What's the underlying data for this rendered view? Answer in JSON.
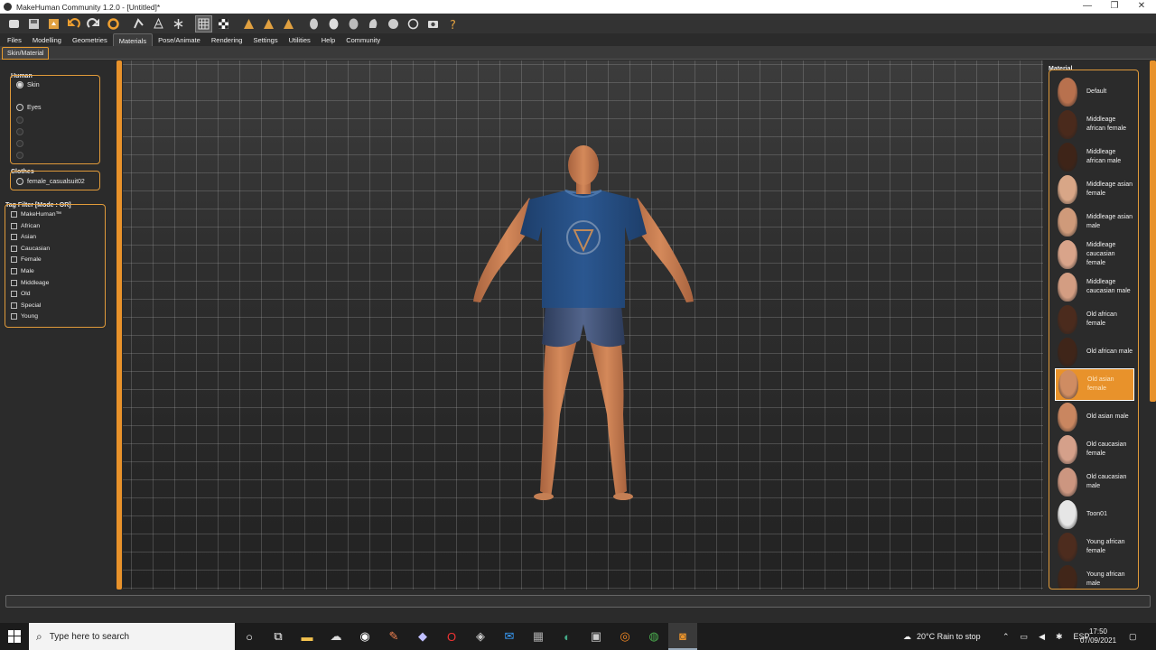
{
  "window": {
    "title": "MakeHuman Community 1.2.0 - [Untitled]*",
    "minimize": "—",
    "maximize": "❐",
    "close": "✕"
  },
  "toolbar": {
    "icons": [
      "new-icon",
      "save-icon",
      "export-icon",
      "undo-icon",
      "redo-icon",
      "reset-icon",
      "pose-icon",
      "wireframe-icon",
      "skeleton-icon",
      "grid-icon",
      "checker-icon",
      "front-view-icon",
      "side-view-icon",
      "top-view-icon",
      "face-front-icon",
      "face-side-icon",
      "face-back-icon",
      "face-left-icon",
      "face-right-icon",
      "reset-camera-icon",
      "snapshot-icon",
      "help-icon"
    ]
  },
  "tabs": [
    {
      "label": "Files"
    },
    {
      "label": "Modelling"
    },
    {
      "label": "Geometries"
    },
    {
      "label": "Materials",
      "active": true
    },
    {
      "label": "Pose/Animate"
    },
    {
      "label": "Rendering"
    },
    {
      "label": "Settings"
    },
    {
      "label": "Utilities"
    },
    {
      "label": "Help"
    },
    {
      "label": "Community"
    }
  ],
  "subtab": {
    "label": "Skin/Material"
  },
  "left": {
    "human": {
      "title": "Human",
      "options": [
        {
          "label": "Skin",
          "selected": true
        },
        {
          "label": "Eyes",
          "selected": false
        }
      ]
    },
    "clothes": {
      "title": "Clothes",
      "item": "female_casualsuit02"
    },
    "tagfilter": {
      "title": "Tag Filter [Mode : OR]",
      "tags": [
        "MakeHuman™",
        "African",
        "Asian",
        "Caucasian",
        "Female",
        "Male",
        "Middleage",
        "Old",
        "Special",
        "Young"
      ]
    }
  },
  "material": {
    "title": "Material",
    "items": [
      {
        "label": "Default",
        "tone": "#b8714e"
      },
      {
        "label": "Middleage african female",
        "tone": "#4a2a1c"
      },
      {
        "label": "Middleage african male",
        "tone": "#3e2418"
      },
      {
        "label": "Middleage asian female",
        "tone": "#d8a687"
      },
      {
        "label": "Middleage asian male",
        "tone": "#cf9a7a"
      },
      {
        "label": "Middleage caucasian female",
        "tone": "#d9a48a"
      },
      {
        "label": "Middleage caucasian male",
        "tone": "#d39d82"
      },
      {
        "label": "Old african female",
        "tone": "#4b2b1d"
      },
      {
        "label": "Old african male",
        "tone": "#3f2519"
      },
      {
        "label": "Old asian female",
        "tone": "#cf8c62",
        "selected": true
      },
      {
        "label": "Old asian male",
        "tone": "#c98660"
      },
      {
        "label": "Old caucasian female",
        "tone": "#d5a08a"
      },
      {
        "label": "Old caucasian male",
        "tone": "#cc9680"
      },
      {
        "label": "Toon01",
        "tone": "#e6e6e6"
      },
      {
        "label": "Young african female",
        "tone": "#4d2c1e"
      },
      {
        "label": "Young african male",
        "tone": "#412619"
      }
    ]
  },
  "taskbar": {
    "search_placeholder": "Type here to search",
    "weather": "20°C  Rain to stop",
    "lang": "ESP",
    "time": "17:50",
    "date": "07/09/2021"
  }
}
